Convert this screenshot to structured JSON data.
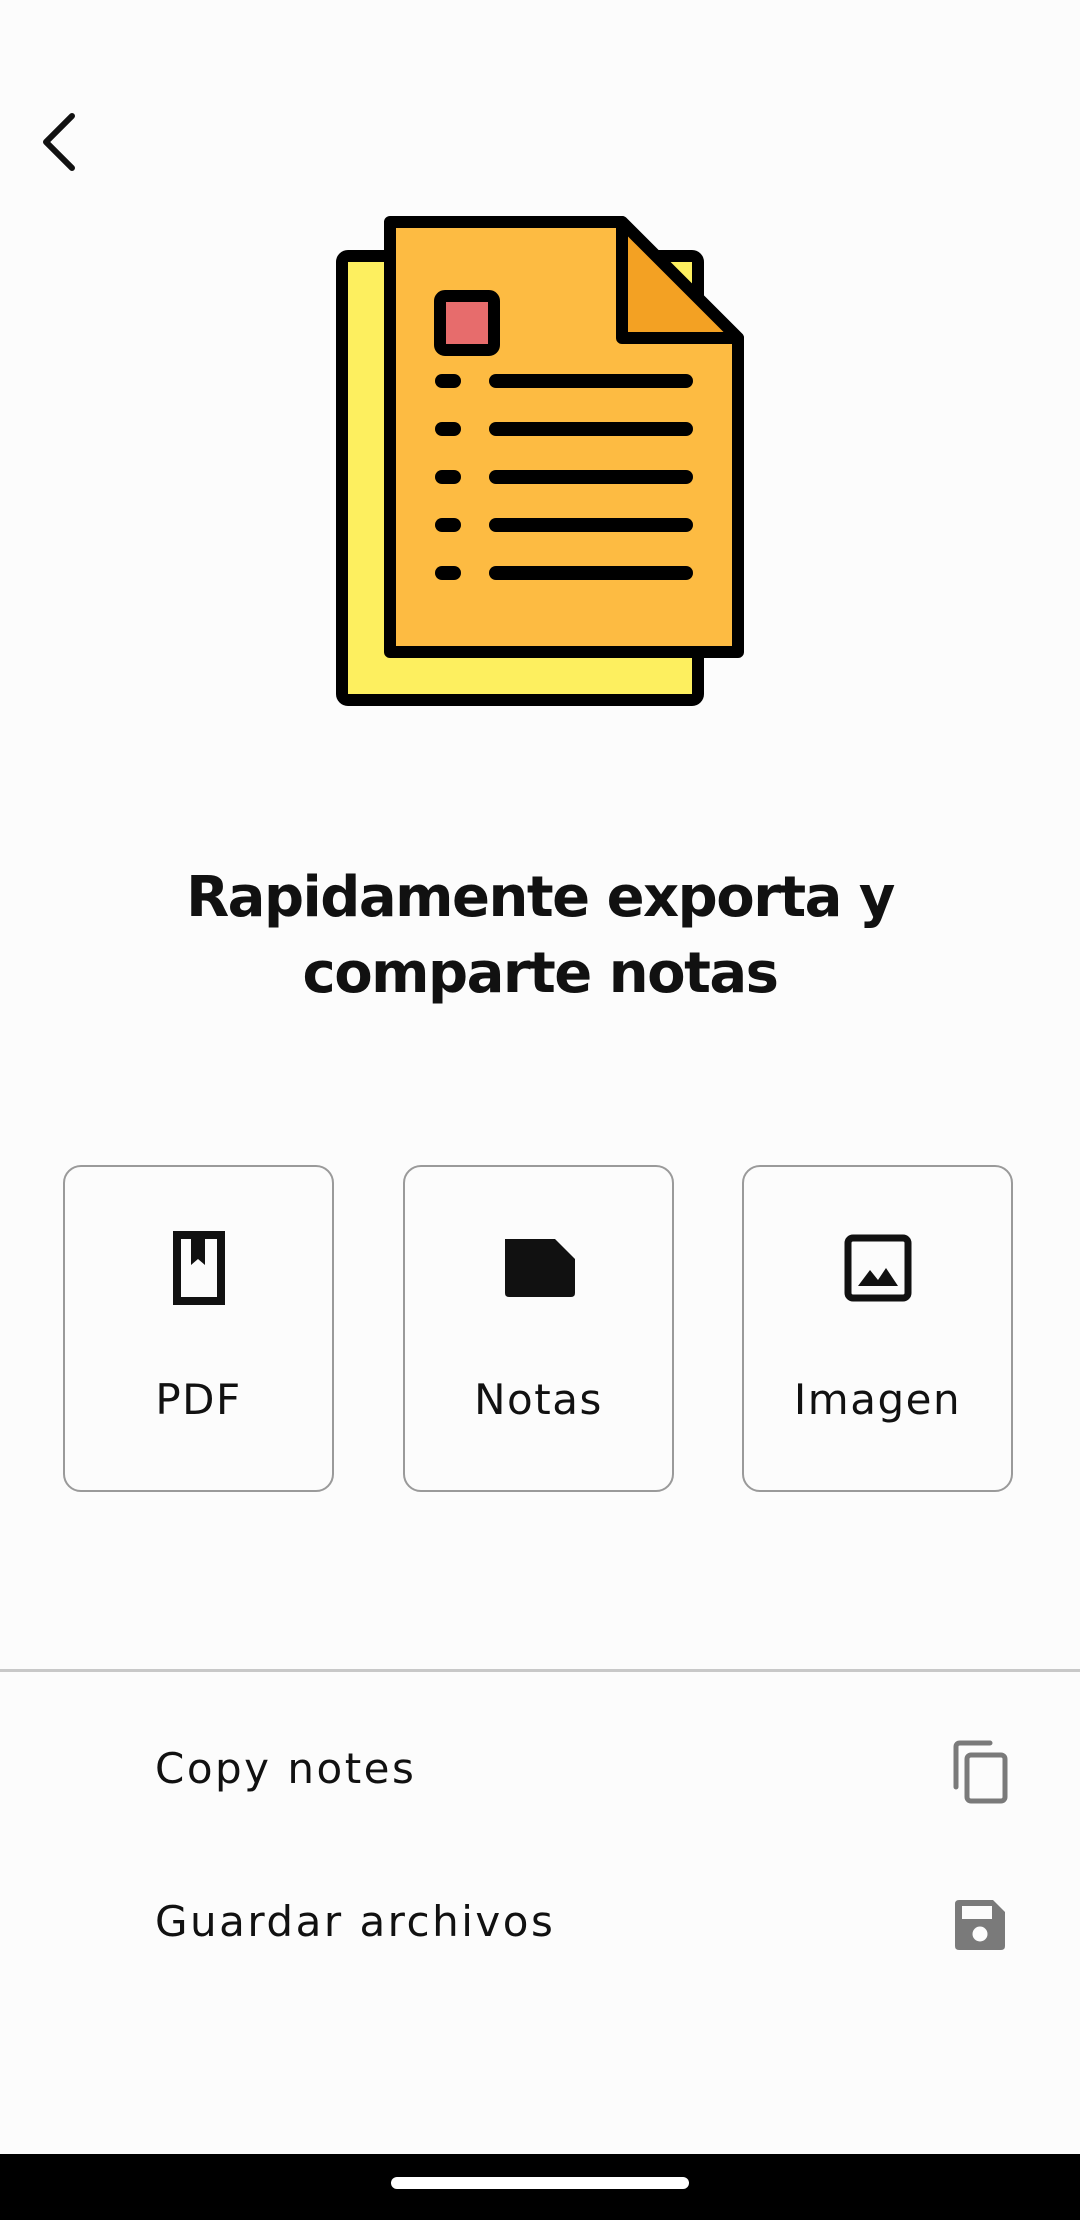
{
  "header": {
    "back_icon": "chevron-left-icon"
  },
  "hero": {
    "illustration": "document-stack-icon",
    "colors": {
      "back_sheet": "#fdef5f",
      "front_sheet": "#fdbb42",
      "fold": "#f3a123",
      "marker": "#e76c6c",
      "outline": "#000000"
    }
  },
  "headline": {
    "line1": "Rapidamente exporta y",
    "line2": "comparte notas"
  },
  "options": [
    {
      "label": "PDF",
      "icon": "book-icon"
    },
    {
      "label": "Notas",
      "icon": "note-icon"
    },
    {
      "label": "Imagen",
      "icon": "image-icon"
    }
  ],
  "actions": [
    {
      "label": "Copy notes",
      "icon": "copy-icon"
    },
    {
      "label": "Guardar archivos",
      "icon": "save-icon"
    }
  ],
  "colors": {
    "background": "#fcfcfc",
    "text": "#111111",
    "card_border": "#9a9a9a",
    "divider": "#c8c8c8",
    "trailing_icon": "#7a7a7a",
    "nav_bar": "#000000"
  }
}
